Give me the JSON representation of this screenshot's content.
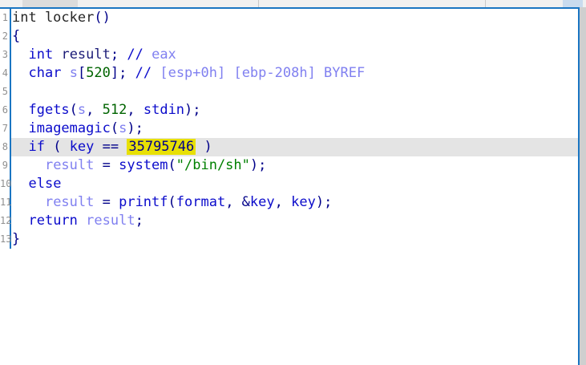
{
  "colors": {
    "border_blue": "#1a75c2",
    "strip_bg": "#f0f0f0",
    "strip_tab": "#dcdcdc",
    "strip_sep": "#c8c8c8",
    "strip_chip": "#c9dbee",
    "rail": "#cfcfcf",
    "gutter_num": "#8f8f8f",
    "curline": "#e4e4e4",
    "hl_bg": "#e8e005",
    "hl_text": "#00008b",
    "proto": "#262626",
    "kw": "#0b0bcb",
    "func": "#0b0bcb",
    "punct": "#000089",
    "decl": "#1c1c78",
    "local": "#8080f0",
    "comment": "#8080f0",
    "number": "#006400",
    "string": "#008000"
  },
  "code": {
    "current_line": 8,
    "highlight_value": "35795746",
    "lines": [
      {
        "n": "1",
        "tokens": [
          {
            "t": "int locker",
            "c": "proto"
          },
          {
            "t": "()",
            "c": "punct"
          }
        ]
      },
      {
        "n": "2",
        "tokens": [
          {
            "t": "{",
            "c": "punct"
          }
        ]
      },
      {
        "n": "3",
        "tokens": [
          {
            "t": "  ",
            "c": "ws"
          },
          {
            "t": "int",
            "c": "kw"
          },
          {
            "t": " ",
            "c": "ws"
          },
          {
            "t": "result",
            "c": "decl"
          },
          {
            "t": "; ",
            "c": "punct"
          },
          {
            "t": "//",
            "c": "kw"
          },
          {
            "t": " eax",
            "c": "comment"
          }
        ]
      },
      {
        "n": "4",
        "tokens": [
          {
            "t": "  ",
            "c": "ws"
          },
          {
            "t": "char",
            "c": "kw"
          },
          {
            "t": " ",
            "c": "ws"
          },
          {
            "t": "s",
            "c": "local"
          },
          {
            "t": "[",
            "c": "punct"
          },
          {
            "t": "520",
            "c": "number"
          },
          {
            "t": "]; ",
            "c": "punct"
          },
          {
            "t": "//",
            "c": "kw"
          },
          {
            "t": " [esp+0h] [ebp-208h] BYREF",
            "c": "comment"
          }
        ]
      },
      {
        "n": "5",
        "tokens": []
      },
      {
        "n": "6",
        "tokens": [
          {
            "t": "  ",
            "c": "ws"
          },
          {
            "t": "fgets",
            "c": "func"
          },
          {
            "t": "(",
            "c": "punct"
          },
          {
            "t": "s",
            "c": "local"
          },
          {
            "t": ", ",
            "c": "punct"
          },
          {
            "t": "512",
            "c": "number"
          },
          {
            "t": ", ",
            "c": "punct"
          },
          {
            "t": "stdin",
            "c": "func"
          },
          {
            "t": ");",
            "c": "punct"
          }
        ]
      },
      {
        "n": "7",
        "tokens": [
          {
            "t": "  ",
            "c": "ws"
          },
          {
            "t": "imagemagic",
            "c": "func"
          },
          {
            "t": "(",
            "c": "punct"
          },
          {
            "t": "s",
            "c": "local"
          },
          {
            "t": ");",
            "c": "punct"
          }
        ]
      },
      {
        "n": "8",
        "tokens": [
          {
            "t": "  ",
            "c": "ws"
          },
          {
            "t": "if",
            "c": "kw"
          },
          {
            "t": " ( ",
            "c": "punct"
          },
          {
            "t": "key",
            "c": "func"
          },
          {
            "t": " == ",
            "c": "punct"
          },
          {
            "t": "35795746",
            "c": "numhl"
          },
          {
            "t": " )",
            "c": "punct"
          }
        ]
      },
      {
        "n": "9",
        "tokens": [
          {
            "t": "    ",
            "c": "ws"
          },
          {
            "t": "result",
            "c": "local"
          },
          {
            "t": " = ",
            "c": "punct"
          },
          {
            "t": "system",
            "c": "func"
          },
          {
            "t": "(",
            "c": "punct"
          },
          {
            "t": "\"/bin/sh\"",
            "c": "string"
          },
          {
            "t": ");",
            "c": "punct"
          }
        ]
      },
      {
        "n": "10",
        "tokens": [
          {
            "t": "  ",
            "c": "ws"
          },
          {
            "t": "else",
            "c": "kw"
          }
        ]
      },
      {
        "n": "11",
        "tokens": [
          {
            "t": "    ",
            "c": "ws"
          },
          {
            "t": "result",
            "c": "local"
          },
          {
            "t": " = ",
            "c": "punct"
          },
          {
            "t": "printf",
            "c": "func"
          },
          {
            "t": "(",
            "c": "punct"
          },
          {
            "t": "format",
            "c": "func"
          },
          {
            "t": ", ",
            "c": "punct"
          },
          {
            "t": "&",
            "c": "punct"
          },
          {
            "t": "key",
            "c": "func"
          },
          {
            "t": ", ",
            "c": "punct"
          },
          {
            "t": "key",
            "c": "func"
          },
          {
            "t": ");",
            "c": "punct"
          }
        ]
      },
      {
        "n": "12",
        "tokens": [
          {
            "t": "  ",
            "c": "ws"
          },
          {
            "t": "return",
            "c": "kw"
          },
          {
            "t": " ",
            "c": "ws"
          },
          {
            "t": "result",
            "c": "local"
          },
          {
            "t": ";",
            "c": "punct"
          }
        ]
      },
      {
        "n": "13",
        "tokens": [
          {
            "t": "}",
            "c": "punct"
          }
        ]
      }
    ]
  }
}
